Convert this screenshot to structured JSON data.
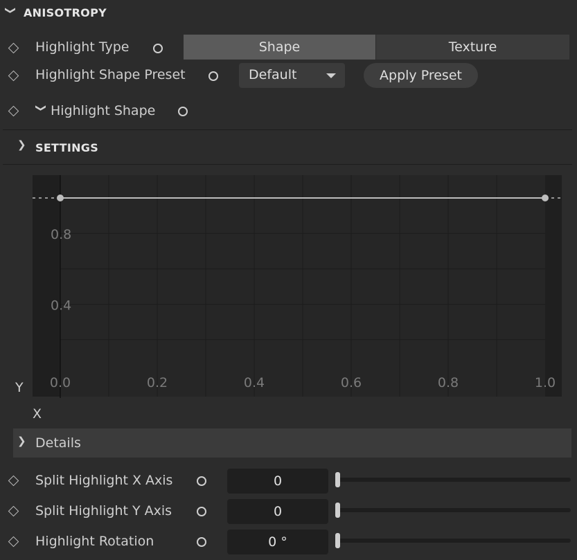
{
  "section": {
    "title": "ANISOTROPY"
  },
  "highlight_type": {
    "label": "Highlight Type",
    "options": [
      "Shape",
      "Texture"
    ],
    "selected": "Shape"
  },
  "shape_preset": {
    "label": "Highlight Shape Preset",
    "value": "Default",
    "apply_label": "Apply Preset"
  },
  "highlight_shape": {
    "label": "Highlight Shape"
  },
  "settings": {
    "title": "SETTINGS"
  },
  "chart_data": {
    "type": "line",
    "series": [
      {
        "x": [
          0.0,
          1.0
        ],
        "y": [
          1.0,
          1.0
        ]
      }
    ],
    "x_ticks": [
      "0.0",
      "0.2",
      "0.4",
      "0.6",
      "0.8",
      "1.0"
    ],
    "y_ticks": [
      "0.8",
      "0.4"
    ],
    "xlabel": "X",
    "ylabel": "Y",
    "xlim": [
      0,
      1
    ],
    "ylim": [
      0,
      1
    ],
    "grid": true
  },
  "details": {
    "label": "Details"
  },
  "params": [
    {
      "label": "Split Highlight X Axis",
      "value": "0",
      "slider": 0
    },
    {
      "label": "Split Highlight Y Axis",
      "value": "0",
      "slider": 0
    },
    {
      "label": "Highlight Rotation",
      "value": "0 °",
      "slider": 0
    }
  ],
  "colors": {
    "background": "#2c2c2c",
    "chart_bg": "#222222",
    "curve": "#bdbdbd",
    "selected_segment": "#5b5b5b"
  }
}
